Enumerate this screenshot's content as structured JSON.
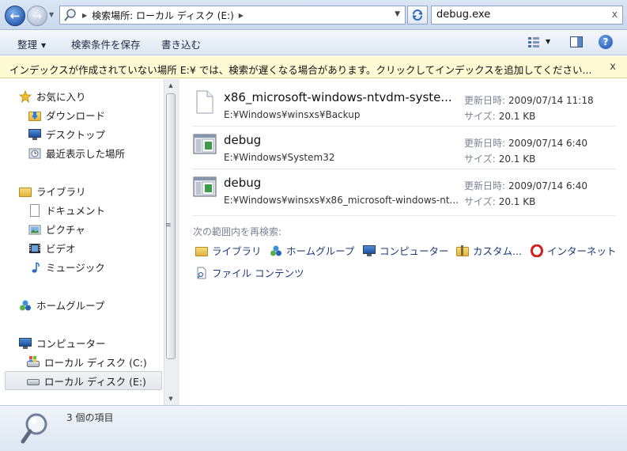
{
  "address": {
    "path": "検索場所: ローカル ディスク (E:)"
  },
  "search": {
    "query": "debug.exe",
    "clear": "x"
  },
  "toolbar": {
    "organize": "整理",
    "save_search": "検索条件を保存",
    "burn": "書き込む"
  },
  "infobar": {
    "message": "インデックスが作成されていない場所 E:¥ では、検索が遅くなる場合があります。クリックしてインデックスを追加してください...",
    "close": "x"
  },
  "sidebar": {
    "favorites": "お気に入り",
    "downloads": "ダウンロード",
    "desktop": "デスクトップ",
    "recent": "最近表示した場所",
    "libraries": "ライブラリ",
    "documents": "ドキュメント",
    "pictures": "ピクチャ",
    "videos": "ビデオ",
    "music": "ミュージック",
    "homegroup": "ホームグループ",
    "computer": "コンピューター",
    "drive_c": "ローカル ディスク (C:)",
    "drive_e": "ローカル ディスク (E:)"
  },
  "results": [
    {
      "name": "x86_microsoft-windows-ntvdm-syste...",
      "path": "E:¥Windows¥winsxs¥Backup",
      "modified_label": "更新日時:",
      "modified": "2009/07/14 11:18",
      "size_label": "サイズ:",
      "size": "20.1 KB",
      "icon": "blank-file-icon"
    },
    {
      "name": "debug",
      "path": "E:¥Windows¥System32",
      "modified_label": "更新日時:",
      "modified": "2009/07/14 6:40",
      "size_label": "サイズ:",
      "size": "20.1 KB",
      "icon": "exe-icon"
    },
    {
      "name": "debug",
      "path": "E:¥Windows¥winsxs¥x86_microsoft-windows-nt...",
      "modified_label": "更新日時:",
      "modified": "2009/07/14 6:40",
      "size_label": "サイズ:",
      "size": "20.1 KB",
      "icon": "exe-icon"
    }
  ],
  "search_again": {
    "label": "次の範囲内を再検索:",
    "libraries": "ライブラリ",
    "homegroup": "ホームグループ",
    "computer": "コンピューター",
    "custom": "カスタム...",
    "internet": "インターネット",
    "file_contents": "ファイル コンテンツ"
  },
  "details": {
    "count": "3 個の項目"
  },
  "colors": {
    "infobar_bg": "#fdfad4",
    "link": "#1c3a78",
    "nav_accent": "#2e63b7"
  }
}
